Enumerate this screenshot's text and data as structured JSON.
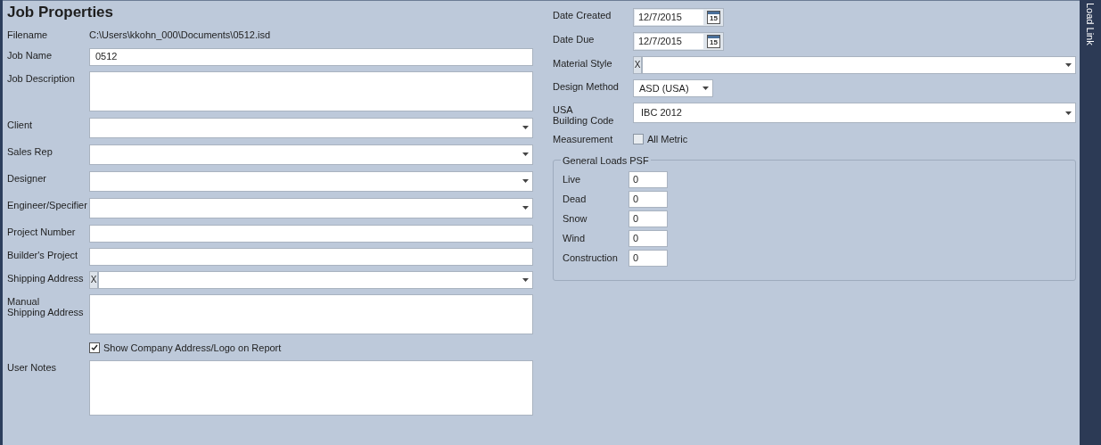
{
  "title": "Job Properties",
  "left": [
    {
      "kind": "info",
      "label": "Filename",
      "value": "C:\\Users\\kkohn_000\\Documents\\0512.isd"
    },
    {
      "kind": "text",
      "label": "Job Name",
      "value": "0512"
    },
    {
      "kind": "textarea",
      "label": "Job Description"
    },
    {
      "kind": "combo",
      "label": "Client"
    },
    {
      "kind": "combo",
      "label": "Sales Rep"
    },
    {
      "kind": "combo",
      "label": "Designer"
    },
    {
      "kind": "combo",
      "label": "Engineer/Specifier"
    },
    {
      "kind": "text",
      "label": "Project Number"
    },
    {
      "kind": "text",
      "label": "Builder's Project"
    },
    {
      "kind": "clearcombo",
      "label": "Shipping Address",
      "clear": "X"
    },
    {
      "kind": "textarea",
      "label": "Manual\nShipping Address"
    },
    {
      "kind": "check",
      "text": "Show Company Address/Logo on Report",
      "checked": true
    },
    {
      "kind": "notes",
      "label": "User Notes"
    }
  ],
  "right": [
    {
      "kind": "date",
      "label": "Date Created",
      "value": "12/7/2015",
      "day": "15"
    },
    {
      "kind": "date",
      "label": "Date Due",
      "value": "12/7/2015",
      "day": "15"
    },
    {
      "kind": "clearcombo",
      "label": "Material Style",
      "clear": "X"
    },
    {
      "kind": "smallcombo",
      "label": "Design Method",
      "value": "ASD (USA)"
    },
    {
      "kind": "combo",
      "label": "USA\nBuilding Code",
      "value": "IBC 2012"
    },
    {
      "kind": "check",
      "label": "Measurement",
      "text": "All Metric",
      "checked": false
    }
  ],
  "loads": {
    "title": "General Loads PSF",
    "rows": [
      {
        "label": "Live",
        "value": "0"
      },
      {
        "label": "Dead",
        "value": "0"
      },
      {
        "label": "Snow",
        "value": "0"
      },
      {
        "label": "Wind",
        "value": "0"
      },
      {
        "label": "Construction",
        "value": "0"
      }
    ]
  },
  "side_tab": "Load Link"
}
